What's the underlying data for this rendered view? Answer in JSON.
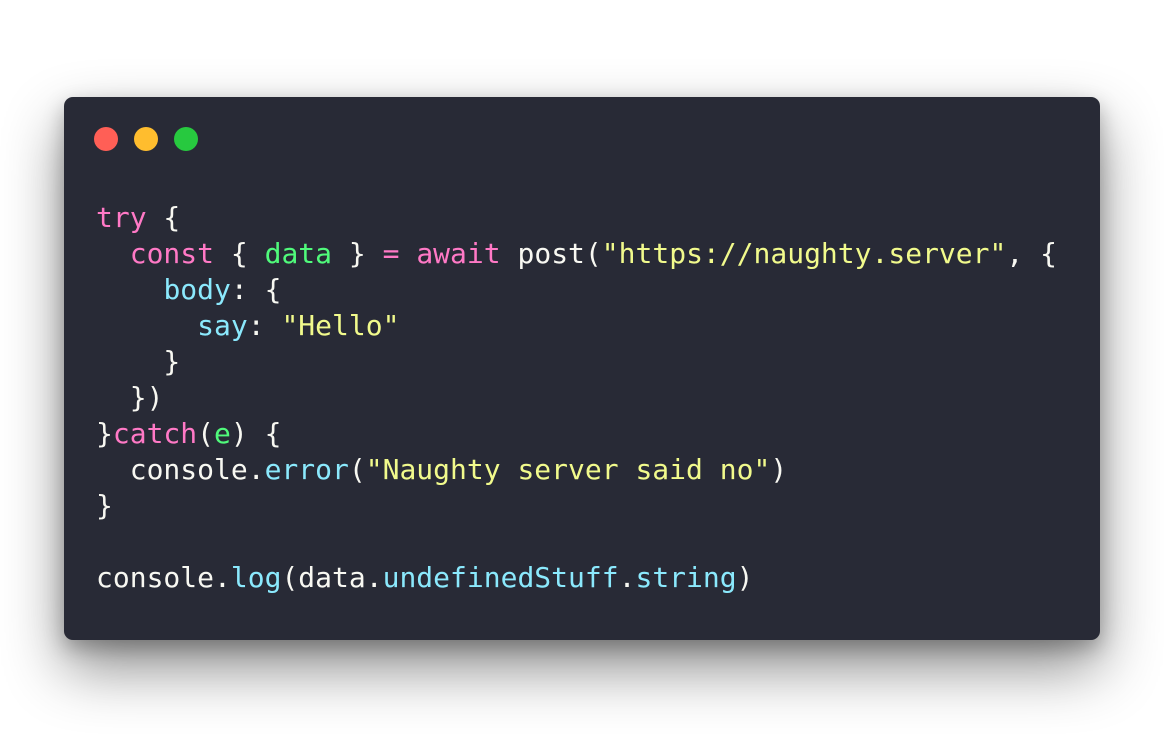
{
  "window": {
    "controls": [
      {
        "name": "close",
        "color": "#ff5f56"
      },
      {
        "name": "minimize",
        "color": "#ffbd2e"
      },
      {
        "name": "zoom",
        "color": "#27c93f"
      }
    ],
    "background": "#282a36"
  },
  "theme": {
    "keyword": "#ff79c6",
    "plain": "#f8f8f2",
    "variable": "#50fa7b",
    "string": "#f1fa8c",
    "property": "#8be9fd"
  },
  "code": {
    "lines": [
      [
        [
          "keyword",
          "try"
        ],
        [
          "plain",
          " {"
        ]
      ],
      [
        [
          "plain",
          "  "
        ],
        [
          "keyword",
          "const"
        ],
        [
          "plain",
          " { "
        ],
        [
          "var",
          "data"
        ],
        [
          "plain",
          " } "
        ],
        [
          "keyword",
          "="
        ],
        [
          "plain",
          " "
        ],
        [
          "keyword",
          "await"
        ],
        [
          "plain",
          " post("
        ],
        [
          "string",
          "\"https://naughty.server\""
        ],
        [
          "plain",
          ", {"
        ]
      ],
      [
        [
          "plain",
          "    "
        ],
        [
          "prop",
          "body"
        ],
        [
          "plain",
          ": {"
        ]
      ],
      [
        [
          "plain",
          "      "
        ],
        [
          "prop",
          "say"
        ],
        [
          "plain",
          ": "
        ],
        [
          "string",
          "\"Hello\""
        ]
      ],
      [
        [
          "plain",
          "    }"
        ]
      ],
      [
        [
          "plain",
          "  })"
        ]
      ],
      [
        [
          "plain",
          "}"
        ],
        [
          "keyword",
          "catch"
        ],
        [
          "plain",
          "("
        ],
        [
          "param",
          "e"
        ],
        [
          "plain",
          ") {"
        ]
      ],
      [
        [
          "plain",
          "  console."
        ],
        [
          "method",
          "error"
        ],
        [
          "plain",
          "("
        ],
        [
          "string",
          "\"Naughty server said no\""
        ],
        [
          "plain",
          ")"
        ]
      ],
      [
        [
          "plain",
          "}"
        ]
      ],
      [],
      [
        [
          "plain",
          "console."
        ],
        [
          "method",
          "log"
        ],
        [
          "plain",
          "(data."
        ],
        [
          "prop",
          "undefinedStuff"
        ],
        [
          "plain",
          "."
        ],
        [
          "prop",
          "string"
        ],
        [
          "plain",
          ")"
        ]
      ]
    ]
  }
}
